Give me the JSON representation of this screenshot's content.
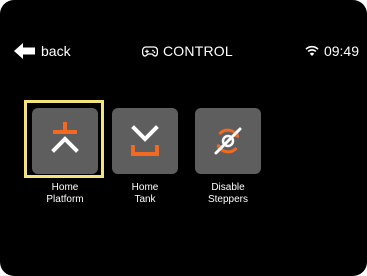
{
  "header": {
    "back_label": "back",
    "title": "CONTROL",
    "time": "09:49"
  },
  "tiles": [
    {
      "line1": "Home",
      "line2": "Platform",
      "icon": "home-platform-icon",
      "selected": true
    },
    {
      "line1": "Home",
      "line2": "Tank",
      "icon": "home-tank-icon",
      "selected": false
    },
    {
      "line1": "Disable",
      "line2": "Steppers",
      "icon": "disable-steppers-icon",
      "selected": false
    }
  ],
  "colors": {
    "background": "#000000",
    "tile": "#5e5e5e",
    "accent": "#f26a21",
    "selection": "#f4e37a",
    "text": "#ffffff"
  }
}
